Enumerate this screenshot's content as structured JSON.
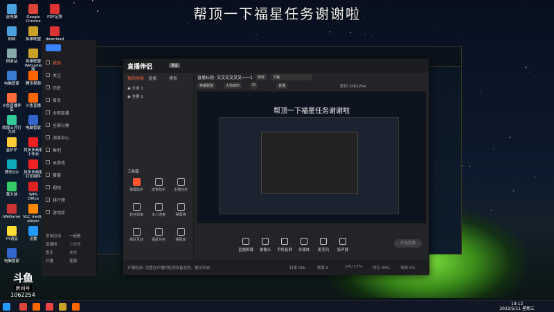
{
  "overlay_title": "帮顶一下福星任务谢谢啦",
  "desktop_icons": [
    {
      "label": "此电脑",
      "color": "#4aa3df"
    },
    {
      "label": "网络",
      "color": "#4aa3df"
    },
    {
      "label": "回收站",
      "color": "#8aa"
    },
    {
      "label": "电脑管家",
      "color": "#3a7bd5"
    },
    {
      "label": "斗鱼直播伴侣",
      "color": "#ff6a3d"
    },
    {
      "label": "辉煌士兵打大师",
      "color": "#3c9"
    },
    {
      "label": "金铲铲",
      "color": "#fc3"
    },
    {
      "label": "腾讯QQ",
      "color": "#1ab"
    },
    {
      "label": "我大侠",
      "color": "#3c6"
    },
    {
      "label": "WeGame",
      "color": "#c33"
    },
    {
      "label": "YY语音",
      "color": "#fd3"
    },
    {
      "label": "电脑管家",
      "color": "#36c"
    },
    {
      "label": "Google Chrome",
      "color": "#db4437"
    },
    {
      "label": "英雄联盟",
      "color": "#c9a227"
    },
    {
      "label": "英雄联盟WeGame版",
      "color": "#c9a227"
    },
    {
      "label": "腾讯视频",
      "color": "#f60"
    },
    {
      "label": "斗鱼直播",
      "color": "#f60"
    },
    {
      "label": "电脑管家",
      "color": "#36c"
    },
    {
      "label": "拼多多商家工作台",
      "color": "#e22"
    },
    {
      "label": "拼多多商家打印组件",
      "color": "#e22"
    },
    {
      "label": "WPS Office",
      "color": "#d22"
    },
    {
      "label": "VLC media player",
      "color": "#f80"
    },
    {
      "label": "迅雷",
      "color": "#29f"
    },
    {
      "label": "PDF证照",
      "color": "#d33"
    },
    {
      "label": "download",
      "color": "#d33"
    }
  ],
  "douyu_nav": [
    "我的",
    "关注",
    "历史",
    "首页",
    "全部直播",
    "全部分类",
    "消息中心",
    "鱼吧",
    "云游戏",
    "赛事",
    "视频",
    "排行榜",
    "游戏库"
  ],
  "douyu_bottom": [
    "常用应用",
    "一起看",
    "直播间",
    "二次元",
    "鱼乐",
    "文化",
    "开播",
    "客服"
  ],
  "companion": {
    "brand": "直播伴侣",
    "version": "测试",
    "tabs": [
      "我的场景",
      "直播",
      "模板"
    ],
    "scenes": [
      "文本 1",
      "全屏 1"
    ],
    "toolbox_label": "工具箱",
    "tools": [
      "弹幕助手",
      "房管助手",
      "主播任务",
      "粉丝勋章",
      "多人连麦",
      "弹幕墙",
      "组队互动",
      "福星任务",
      "弹幕库"
    ],
    "title_label": "直播标题:",
    "title_value": "艾艾艾艾艾艾一一1",
    "edit_label": "修改",
    "category": "下路",
    "tags": [
      "英雄联盟",
      "大地城市",
      "ID",
      "直播"
    ],
    "room_info": "房间 1062254",
    "stats": [
      "0",
      "0"
    ],
    "preview_title": "帮顶一下福星任务谢谢啦",
    "bottom_buttons": [
      "直播屏幕",
      "摄像头",
      "手机投屏",
      "多媒体",
      "麦克风",
      "扬声器"
    ],
    "start_live": "开始直播",
    "status_text": "开播检测:  设置在开播时检测设备状态，建议开启",
    "status_metrics": [
      "码率 0Kb",
      "帧率 0",
      "CPU 17%",
      "内存 44%",
      "丢帧 0%"
    ]
  },
  "room_badge": {
    "label": "房间号",
    "number": "1062254"
  },
  "clock": {
    "time": "19:12",
    "date": "2022/5/11 星期三"
  }
}
